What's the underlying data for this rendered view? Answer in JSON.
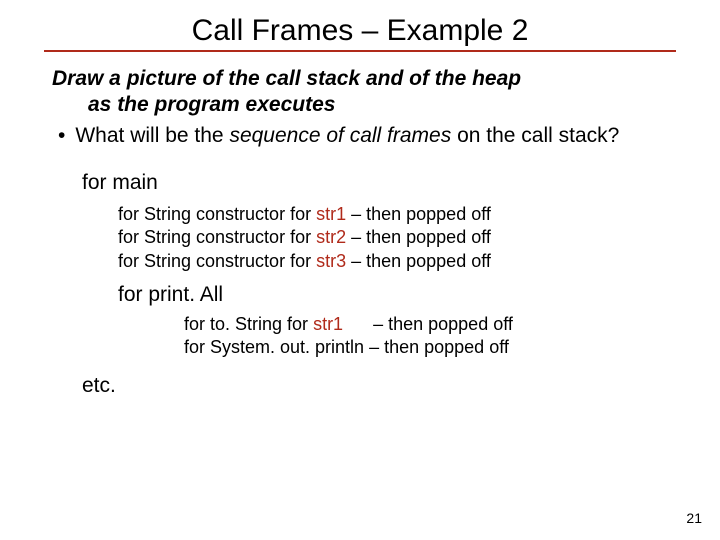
{
  "title": "Call Frames – Example 2",
  "lead_line1": "Draw a picture of the call stack and of the heap",
  "lead_line2": "as the program executes",
  "bullet_pre": "What will be the ",
  "bullet_italic": "sequence of call frames",
  "bullet_post": " on the call stack?",
  "for_main": "for main",
  "cons": {
    "pre": "for String constructor for ",
    "s1": "str1",
    "s2": "str2",
    "s3": "str3",
    "post": " – then popped off"
  },
  "for_printall": "for print. All",
  "print1_pre": "for to. String for ",
  "print1_hl": "str1",
  "print1_gap": "      ",
  "print1_post": "– then popped off",
  "print2_pre": "for System. out. println ",
  "print2_post": "– then popped off",
  "etc": "etc.",
  "pagenum": "21"
}
